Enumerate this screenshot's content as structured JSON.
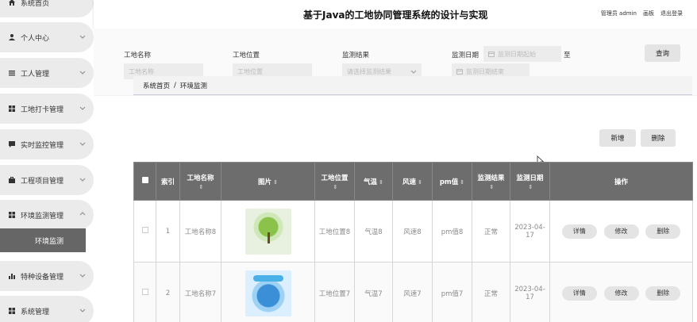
{
  "header": {
    "title": "基于Java的工地协同管理系统的设计与实现",
    "admin_label": "管理员 admin",
    "skin_label": "画板",
    "logout_label": "退出登录"
  },
  "sidebar": {
    "items": [
      {
        "label": "系统首页",
        "icon": "home-icon"
      },
      {
        "label": "个人中心",
        "icon": "user-icon"
      },
      {
        "label": "工人管理",
        "icon": "list-icon"
      },
      {
        "label": "工地打卡管理",
        "icon": "grid-icon"
      },
      {
        "label": "实时监控管理",
        "icon": "message-icon"
      },
      {
        "label": "工程项目管理",
        "icon": "briefcase-icon"
      },
      {
        "label": "环境监测管理",
        "icon": "grid-icon"
      },
      {
        "label": "特种设备管理",
        "icon": "bar-chart-icon"
      },
      {
        "label": "系统管理",
        "icon": "grid-icon"
      }
    ],
    "sub_item": "环境监测"
  },
  "search": {
    "site_name_label": "工地名称",
    "site_name_placeholder": "工地名称",
    "site_location_label": "工地位置",
    "site_location_placeholder": "工地位置",
    "result_label": "监测结果",
    "result_placeholder": "请选择监测结果",
    "date_label": "监测日期",
    "date_start_placeholder": "监测日期起始",
    "date_separator": "至",
    "date_end_placeholder": "监测日期结束",
    "query_button": "查询"
  },
  "breadcrumb": {
    "home": "系统首页",
    "separator": "/",
    "current": "环境监测"
  },
  "toolbar": {
    "add_button": "新增",
    "delete_button": "删除"
  },
  "table": {
    "columns": [
      "索引",
      "工地名称",
      "图片",
      "工地位置",
      "气温",
      "风速",
      "pm值",
      "监测结果",
      "监测日期",
      "操作"
    ],
    "rows": [
      {
        "index": "1",
        "site_name": "工地名称8",
        "location": "工地位置8",
        "temp": "气温8",
        "wind": "风速8",
        "pm": "pm值8",
        "result": "正常",
        "date": "2023-04-17"
      },
      {
        "index": "2",
        "site_name": "工地名称7",
        "location": "工地位置7",
        "temp": "气温7",
        "wind": "风速7",
        "pm": "pm值7",
        "result": "正常",
        "date": "2023-04-17"
      }
    ],
    "actions": {
      "detail": "详情",
      "edit": "修改",
      "delete": "删除"
    }
  }
}
